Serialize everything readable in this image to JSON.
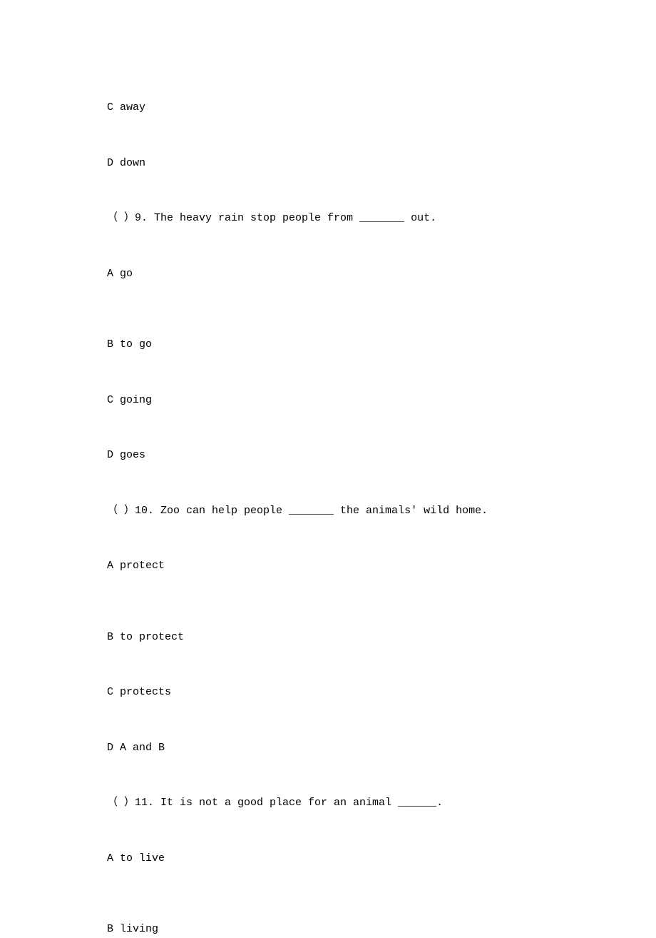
{
  "lines": [
    {
      "text": "C away",
      "class": "option-line"
    },
    {
      "text": "D down",
      "class": "option-line"
    },
    {
      "text": "（ ）9. The heavy rain stop people from _______ out.",
      "class": "question-line"
    },
    {
      "text": "A go",
      "class": "option-line first-option"
    },
    {
      "text": "B to go",
      "class": "option-line"
    },
    {
      "text": "C going",
      "class": "option-line"
    },
    {
      "text": "D goes",
      "class": "option-line"
    },
    {
      "text": "（ ）10. Zoo can help people _______ the animals' wild home.",
      "class": "question-line"
    },
    {
      "text": "A protect",
      "class": "option-line first-option"
    },
    {
      "text": "B to protect",
      "class": "option-line"
    },
    {
      "text": "C protects",
      "class": "option-line"
    },
    {
      "text": "D A and B",
      "class": "option-line"
    },
    {
      "text": "（ ）11. It is not a good place for an animal ______.",
      "class": "question-line"
    },
    {
      "text": "A to live",
      "class": "option-line first-option"
    },
    {
      "text": "B living",
      "class": "option-line"
    }
  ]
}
